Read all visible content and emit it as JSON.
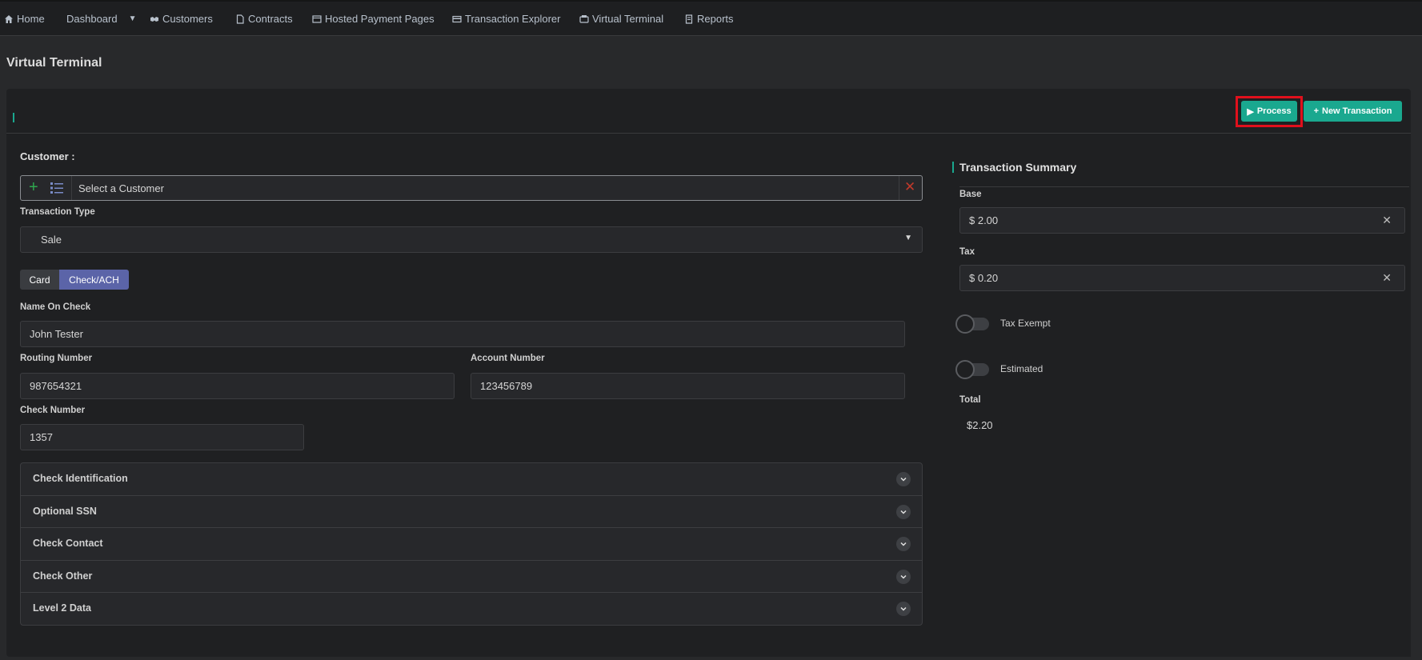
{
  "nav": {
    "items": [
      {
        "label": "Home",
        "icon": "home-icon"
      },
      {
        "label": "Dashboard",
        "icon": "caret-down-icon"
      },
      {
        "label": "Customers",
        "icon": "handshake-icon"
      },
      {
        "label": "Contracts",
        "icon": "file-icon"
      },
      {
        "label": "Hosted Payment Pages",
        "icon": "page-icon"
      },
      {
        "label": "Transaction Explorer",
        "icon": "card-icon"
      },
      {
        "label": "Virtual Terminal",
        "icon": "terminal-icon"
      },
      {
        "label": "Reports",
        "icon": "report-icon"
      }
    ]
  },
  "page": {
    "title": "Virtual Terminal"
  },
  "toolbar": {
    "process_label": "Process",
    "new_transaction_label": "New Transaction"
  },
  "customer": {
    "label": "Customer :",
    "placeholder": "Select a Customer"
  },
  "transaction_type": {
    "label": "Transaction Type",
    "value": "Sale"
  },
  "payment_tabs": {
    "card": "Card",
    "ach": "Check/ACH",
    "active": "Check/ACH"
  },
  "form": {
    "name_on_check": {
      "label": "Name On Check",
      "value": "John Tester"
    },
    "routing_number": {
      "label": "Routing Number",
      "value": "987654321"
    },
    "account_number": {
      "label": "Account Number",
      "value": "123456789"
    },
    "check_number": {
      "label": "Check Number",
      "value": "1357"
    }
  },
  "accordion": [
    "Check Identification",
    "Optional SSN",
    "Check Contact",
    "Check Other",
    "Level 2 Data"
  ],
  "summary": {
    "title": "Transaction Summary",
    "base_label": "Base",
    "base_value": "$ 2.00",
    "tax_label": "Tax",
    "tax_value": "$ 0.20",
    "tax_exempt_label": "Tax Exempt",
    "tax_exempt_on": false,
    "estimated_label": "Estimated",
    "estimated_on": false,
    "total_label": "Total",
    "total_value": "$2.20"
  },
  "colors": {
    "accent": "#1aa88f",
    "highlight": "#e0101c",
    "active_tab": "#5b64a8"
  }
}
